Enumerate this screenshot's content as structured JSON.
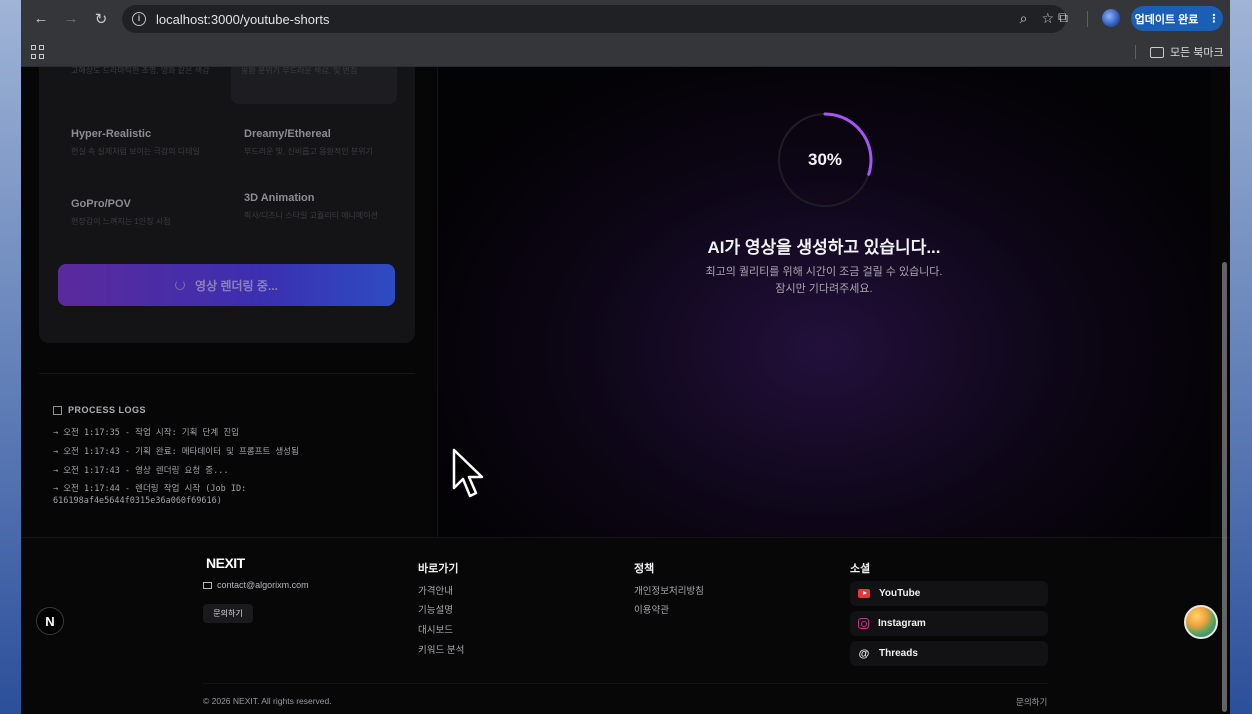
{
  "browser": {
    "url": "localhost:3000/youtube-shorts",
    "update_button_label": "업데이트 완료",
    "bookmark_folder": "모든 북마크"
  },
  "left_card": {
    "top_item_descs": [
      "고해상도 드라마틱한 조명, 영화 같은 색감",
      "몽환 분위기 부드러운 색감, 빛 번짐"
    ],
    "styles": [
      {
        "name": "Hyper-Realistic",
        "desc": "현실 속 실제처럼 보이는 극강의 디테일"
      },
      {
        "name": "Dreamy/Ethereal",
        "desc": "부드러운 빛, 신비롭고 몽환적인 분위기"
      },
      {
        "name": "GoPro/POV",
        "desc": "현장감이 느껴지는 1인칭 시점"
      },
      {
        "name": "3D Animation",
        "desc": "픽사/디즈니 스타일 고퀄리티 애니메이션"
      }
    ],
    "render_button_label": "영상 렌더링 중..."
  },
  "logs": {
    "title": "PROCESS LOGS",
    "lines": [
      "→ 오전 1:17:35 - 작업 시작: 기획 단계 진입",
      "→ 오전 1:17:43 - 기획 완료: 메타데이터 및 프롬프트 생성됨",
      "→ 오전 1:17:43 - 영상 렌더링 요청 중...",
      "→ 오전 1:17:44 - 렌더링 작업 시작 (Job ID: 616198af4e5644f0315e36a060f69616)"
    ]
  },
  "generation": {
    "progress_value": 30,
    "progress_label": "30%",
    "title": "AI가 영상을 생성하고 있습니다...",
    "subtitle_line1": "최고의 퀄리티를 위해 시간이 조금 걸릴 수 있습니다.",
    "subtitle_line2": "잠시만 기다려주세요.",
    "ring_color": "#a855f7"
  },
  "footer": {
    "logo": "NEXIT",
    "email": "contact@algorixm.com",
    "contact_button": "문의하기",
    "nav": {
      "title": "바로가기",
      "links": [
        "가격안내",
        "기능설명",
        "대시보드",
        "키워드 분석"
      ]
    },
    "policy": {
      "title": "정책",
      "links": [
        "개인정보처리방침",
        "이용약관"
      ]
    },
    "social": {
      "title": "소셜",
      "links": [
        "YouTube",
        "Instagram",
        "Threads"
      ]
    },
    "copyright": "© 2026 NEXIT. All rights reserved.",
    "bottom_contact": "문의하기"
  },
  "badges": {
    "next_letter": "N"
  }
}
